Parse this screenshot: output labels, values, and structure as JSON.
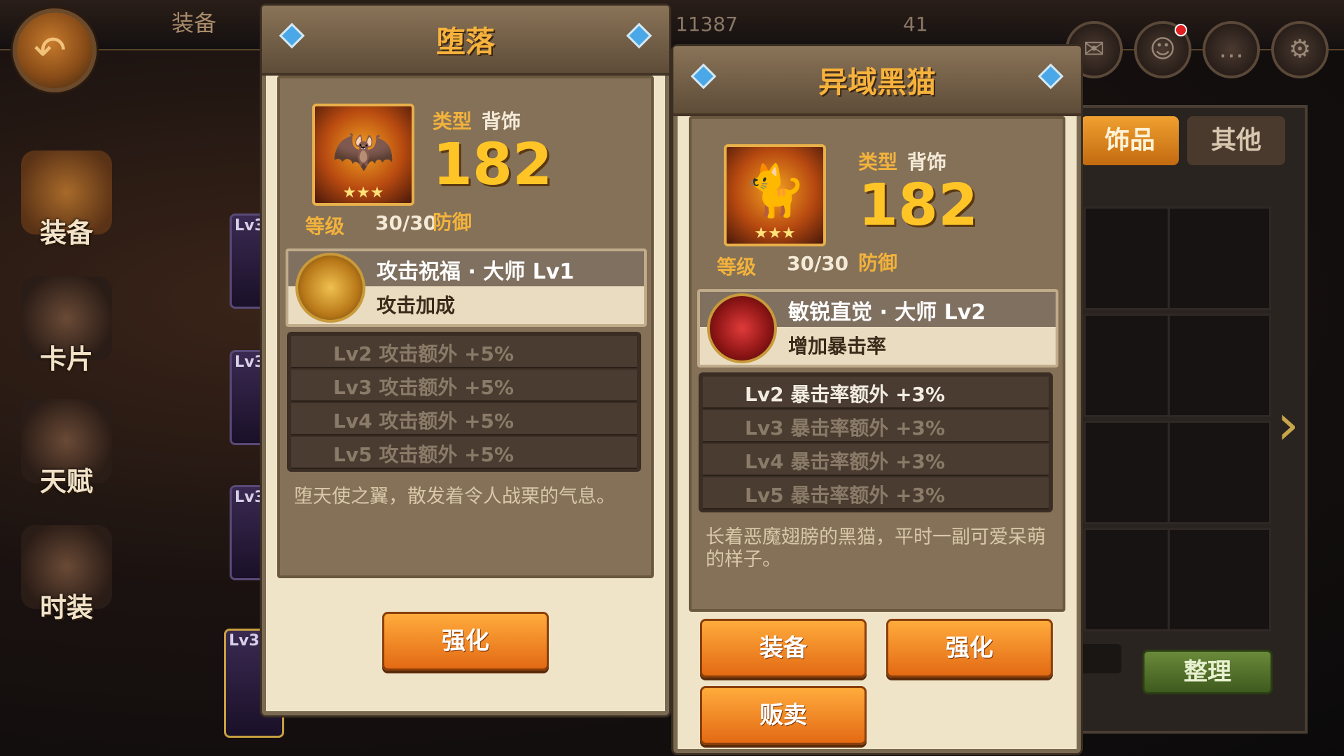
{
  "top": {
    "title": "装备",
    "stat_1": "11387",
    "stat_2": "41",
    "icons": [
      "mail-icon",
      "friends-icon",
      "chat-icon",
      "settings-icon"
    ]
  },
  "sidebar": {
    "items": [
      {
        "label": "装备"
      },
      {
        "label": "卡片"
      },
      {
        "label": "天赋"
      },
      {
        "label": "时装"
      }
    ]
  },
  "slots": [
    "Lv3",
    "Lv3",
    "Lv3",
    "Lv3"
  ],
  "inventory": {
    "tabs": [
      "饰品",
      "其他"
    ],
    "sort_label": "整理"
  },
  "popup_left": {
    "title": "堕落",
    "type_label": "类型",
    "type_value": "背饰",
    "defense_value": "182",
    "defense_label": "防御",
    "level_label": "等级",
    "level_value": "30/30",
    "stars": "★★★",
    "skill_name": "攻击祝福 · 大师 Lv1",
    "skill_desc": "攻击加成",
    "levels": [
      "Lv2  攻击额外 +5%",
      "Lv3  攻击额外 +5%",
      "Lv4  攻击额外 +5%",
      "Lv5  攻击额外 +5%"
    ],
    "description": "堕天使之翼，散发着令人战栗的气息。",
    "buttons": {
      "enhance": "强化"
    }
  },
  "popup_right": {
    "title": "异域黑猫",
    "type_label": "类型",
    "type_value": "背饰",
    "defense_value": "182",
    "defense_label": "防御",
    "level_label": "等级",
    "level_value": "30/30",
    "stars": "★★★",
    "skill_name": "敏锐直觉 · 大师 Lv2",
    "skill_desc": "增加暴击率",
    "levels": [
      "Lv2  暴击率额外 +3%",
      "Lv3  暴击率额外 +3%",
      "Lv4  暴击率额外 +3%",
      "Lv5  暴击率额外 +3%"
    ],
    "description": "长着恶魔翅膀的黑猫，平时一副可爱呆萌的样子。",
    "buttons": {
      "equip": "装备",
      "enhance": "强化",
      "sell": "贩卖"
    }
  }
}
